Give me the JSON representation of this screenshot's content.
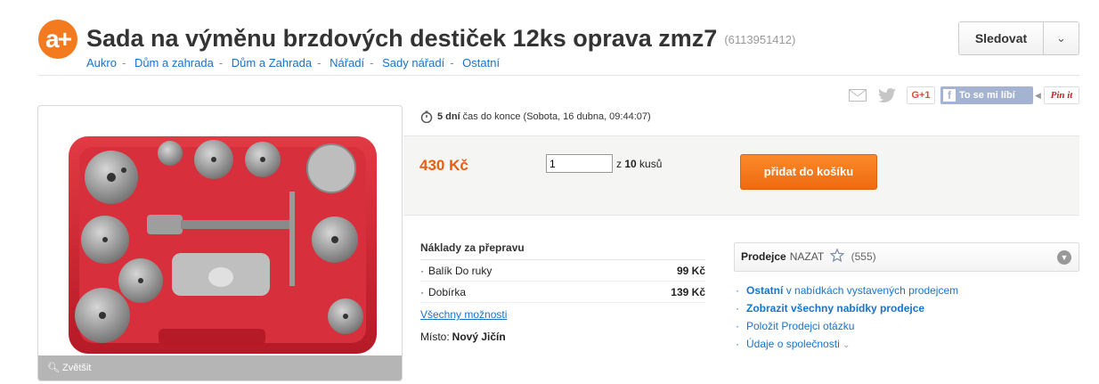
{
  "header": {
    "logo_text": "a+",
    "title": "Sada na výměnu brzdových destiček 12ks oprava zmz7",
    "item_id": "(6113951412)",
    "follow_label": "Sledovat"
  },
  "breadcrumb": [
    "Aukro",
    "Dům a zahrada",
    "Dům a Zahrada",
    "Nářadí",
    "Sady nářadí",
    "Ostatní"
  ],
  "share": {
    "gplus": "G+1",
    "facebook": "To se mi líbí",
    "pinterest": "Pin it"
  },
  "photo": {
    "enlarge_label": "Zvětšit"
  },
  "countdown": {
    "days": "5 dní",
    "text": "čas do konce (Sobota, 16 dubna, 09:44:07)"
  },
  "buy": {
    "price": "430 Kč",
    "quantity": "1",
    "qty_prefix": "z",
    "qty_total": "10",
    "qty_suffix": "kusů",
    "cart_button": "přidat do košíku"
  },
  "shipping": {
    "title": "Náklady za přepravu",
    "options": [
      {
        "name": "Balík Do ruky",
        "price": "99 Kč"
      },
      {
        "name": "Dobírka",
        "price": "139 Kč"
      }
    ],
    "all_options": "Všechny možnosti",
    "place_label": "Místo:",
    "place_value": "Nový Jičín"
  },
  "seller": {
    "label": "Prodejce",
    "name": "NAZAT",
    "rating": "(555)",
    "links": {
      "other_prefix": "Ostatní",
      "other_suffix": "v nabídkách vystavených prodejcem",
      "all_offers": "Zobrazit všechny nabídky prodejce",
      "ask": "Položit Prodejci otázku",
      "company": "Údaje o společnosti"
    }
  },
  "colors": {
    "accent": "#f47a20",
    "price": "#e95d0f",
    "link": "#1a73c8",
    "cart": "#f27416"
  }
}
